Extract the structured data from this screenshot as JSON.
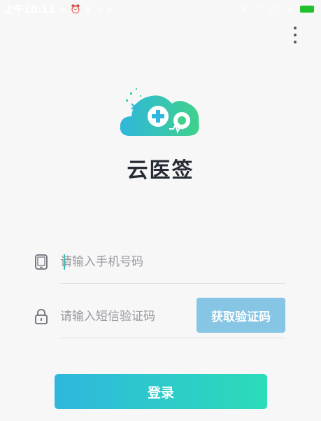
{
  "status_bar": {
    "time": "上午10:12",
    "left_icons": [
      "infinity-icon",
      "alarm-icon",
      "usb-icon",
      "download-icon",
      "check-icon"
    ],
    "right_icons": [
      "mute-icon",
      "wifi-icon",
      "sim-icon",
      "signal-icon",
      "battery-icon"
    ],
    "battery_color": "#22c02a"
  },
  "app": {
    "name": "云医签",
    "logo_icon": "cloud-medical-logo-icon",
    "logo_colors": [
      "#2fb7dd",
      "#3fd18c"
    ]
  },
  "login_form": {
    "phone_placeholder": "请输入手机号码",
    "code_placeholder": "请输入短信验证码",
    "get_code_label": "获取验证码",
    "login_label": "登录",
    "phone_icon": "phone-icon",
    "lock_icon": "lock-icon"
  },
  "colors": {
    "accent_start": "#2fb7dd",
    "accent_end": "#2bdcb8",
    "get_code_bg": "#87c5e4"
  }
}
